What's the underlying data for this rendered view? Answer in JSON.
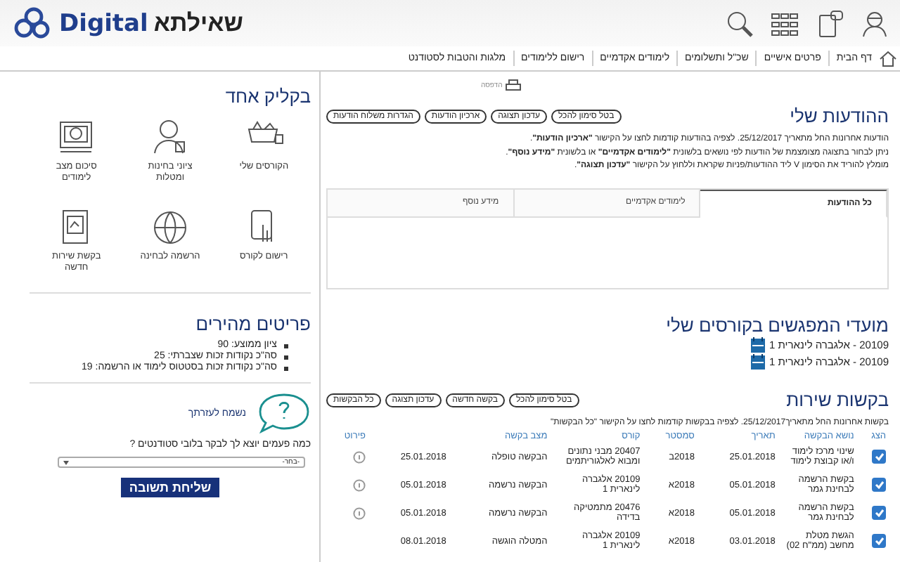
{
  "header": {
    "logo_text": "Digital",
    "site_name": "שאילתא"
  },
  "nav": {
    "items": [
      "דף הבית",
      "פרטים אישיים",
      "שכ\"ל ותשלומים",
      "לימודים אקדמיים",
      "רישום ללימודים",
      "מלגות והטבות לסטודנט"
    ]
  },
  "toolbar": {
    "print_label": "הדפסה"
  },
  "messages": {
    "title": "ההודעות שלי",
    "buttons": [
      "בטל סימון להכל",
      "עדכון תצוגה",
      "ארכיון הודעות",
      "הגדרות משלוח הודעות"
    ],
    "notes": [
      "הודעות אחרונות החל מתאריך 25/12/2017. לצפיה בהודעות קודמות לחצו על הקישור **\"ארכיון הודעות\"**.",
      "ניתן לבחור בתצוגה מצומצמת של הודעות לפי נושאים בלשונית **\"לימודים אקדמיים\"** או בלשונית **\"מידע נוסף\"**.",
      "מומלץ להוריד את הסימון V ליד ההודעות/פניות שקראת וללחוץ על הקישור **\"עדכון תצוגה\"**."
    ],
    "tabs": [
      {
        "label": "כל ההודעות",
        "selected": true
      },
      {
        "label": "לימודים אקדמיים",
        "selected": false
      },
      {
        "label": "מידע נוסף",
        "selected": false
      }
    ]
  },
  "meetings": {
    "title": "מועדי המפגשים בקורסים שלי",
    "items": [
      "20109 - אלגברה לינארית 1",
      "20109 - אלגברה לינארית 1"
    ]
  },
  "requests": {
    "title": "בקשות שירות",
    "buttons": [
      "בטל סימון להכל",
      "בקשה חדשה",
      "עדכון תצוגה",
      "כל הבקשות"
    ],
    "note": "בקשות אחרונות החל מתאריך25/12/2017. לצפיה בבקשות קודמות לחצו על הקישור \"כל הבקשות\"",
    "columns": [
      "הצג",
      "נושא הבקשה",
      "תאריך",
      "סמסטר",
      "קורס",
      "מצב בקשה",
      "פירוט"
    ],
    "rows": [
      {
        "checked": true,
        "subject": "שינוי מרכז לימוד ו/או קבוצת לימוד",
        "date": "25.01.2018",
        "semester": "2018ב",
        "course": "20407 מבני נתונים ומבוא לאלגוריתמים",
        "status": "הבקשה טופלה",
        "status_date": "25.01.2018",
        "details": true
      },
      {
        "checked": true,
        "subject": "בקשת הרשמה לבחינת גמר",
        "date": "05.01.2018",
        "semester": "2018א",
        "course": "20109 אלגברה לינארית 1",
        "status": "הבקשה נרשמה",
        "status_date": "05.01.2018",
        "details": true
      },
      {
        "checked": true,
        "subject": "בקשת הרשמה לבחינת גמר",
        "date": "05.01.2018",
        "semester": "2018א",
        "course": "20476 מתמטיקה בדידה",
        "status": "הבקשה נרשמה",
        "status_date": "05.01.2018",
        "details": true
      },
      {
        "checked": true,
        "subject": "הגשת מטלת מחשב (ממ\"ח 02)",
        "date": "03.01.2018",
        "semester": "2018א",
        "course": "20109 אלגברה לינארית 1",
        "status": "המטלה הוגשה",
        "status_date": "08.01.2018",
        "details": false
      }
    ]
  },
  "sidebar": {
    "quick": {
      "title": "בקליק אחד",
      "items": [
        "הקורסים שלי",
        "ציוני בחינות ומטלות",
        "סיכום מצב לימודים",
        "רישום לקורס",
        "הרשמה לבחינה",
        "בקשת שירות חדשה"
      ]
    },
    "facts": {
      "title": "פריטים מהירים",
      "items": [
        "ציון ממוצע: 90",
        "סה\"כ נקודות זכות שצברתי: 25",
        "סה\"כ נקודות זכות בסטטוס לימוד או הרשמה: 19"
      ]
    },
    "help": {
      "title": "נשמח לעזרתך",
      "question": "כמה פעמים יוצא לך לבקר בלובי סטודנטים ?",
      "select_placeholder": "-בחר-",
      "submit": "שליחת תשובה"
    }
  }
}
